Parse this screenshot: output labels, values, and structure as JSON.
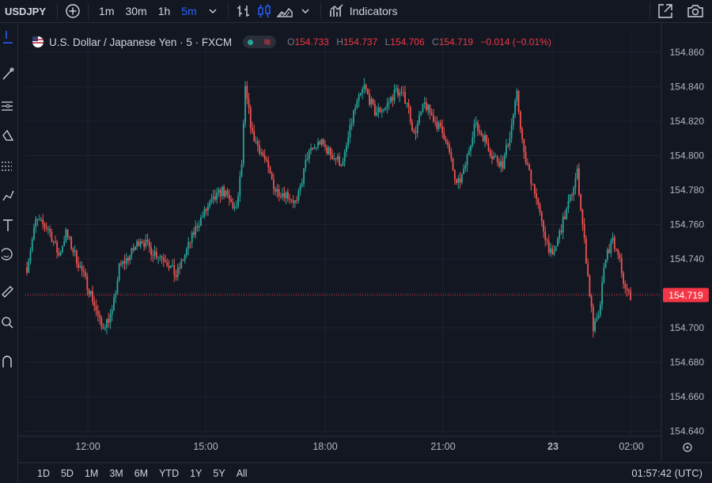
{
  "toolbar": {
    "symbol": "USDJPY",
    "timeframes": [
      "1m",
      "30m",
      "1h",
      "5m"
    ],
    "active_timeframe": "5m",
    "indicators_label": "Indicators"
  },
  "legend": {
    "title": "U.S. Dollar / Japanese Yen · 5 · FXCM",
    "o_label": "O",
    "o": "154.733",
    "h_label": "H",
    "h": "154.737",
    "l_label": "L",
    "l": "154.706",
    "c_label": "C",
    "c": "154.719",
    "change": "−0.014 (−0.01%)"
  },
  "price_axis": {
    "ticks": [
      "154.860",
      "154.840",
      "154.820",
      "154.800",
      "154.780",
      "154.760",
      "154.740",
      "154.720",
      "154.700",
      "154.680",
      "154.660",
      "154.640"
    ],
    "current_price": "154.719"
  },
  "time_axis": {
    "labels": [
      "12:00",
      "15:00",
      "18:00",
      "21:00",
      "23",
      "02:00"
    ]
  },
  "ranges": [
    "1D",
    "5D",
    "1M",
    "3M",
    "6M",
    "YTD",
    "1Y",
    "5Y",
    "All"
  ],
  "clock": "01:57:42 (UTC)",
  "colors": {
    "background": "#131722",
    "up": "#26a69a",
    "down": "#ef5350",
    "accent": "#2962ff",
    "last_price_label": "#f23645"
  },
  "chart_data": {
    "type": "candlestick",
    "timeframe": "5m",
    "ylim": [
      154.635,
      154.865
    ],
    "yticks": [
      154.64,
      154.66,
      154.68,
      154.7,
      154.72,
      154.74,
      154.76,
      154.78,
      154.8,
      154.82,
      154.84,
      154.86
    ],
    "xticks": [
      "12:00",
      "15:00",
      "18:00",
      "21:00",
      "23",
      "02:00"
    ],
    "last_price": 154.719,
    "close_path": [
      [
        0,
        154.735
      ],
      [
        5,
        154.762
      ],
      [
        12,
        154.758
      ],
      [
        18,
        154.742
      ],
      [
        22,
        154.755
      ],
      [
        30,
        154.735
      ],
      [
        36,
        154.72
      ],
      [
        42,
        154.7
      ],
      [
        48,
        154.708
      ],
      [
        52,
        154.735
      ],
      [
        58,
        154.742
      ],
      [
        64,
        154.752
      ],
      [
        70,
        154.745
      ],
      [
        78,
        154.74
      ],
      [
        84,
        154.73
      ],
      [
        90,
        154.745
      ],
      [
        96,
        154.76
      ],
      [
        102,
        154.77
      ],
      [
        110,
        154.78
      ],
      [
        118,
        154.768
      ],
      [
        121,
        154.795
      ],
      [
        123,
        154.838
      ],
      [
        127,
        154.812
      ],
      [
        133,
        154.8
      ],
      [
        140,
        154.78
      ],
      [
        146,
        154.778
      ],
      [
        152,
        154.772
      ],
      [
        158,
        154.8
      ],
      [
        165,
        154.808
      ],
      [
        172,
        154.8
      ],
      [
        178,
        154.795
      ],
      [
        184,
        154.825
      ],
      [
        190,
        154.84
      ],
      [
        196,
        154.825
      ],
      [
        202,
        154.828
      ],
      [
        208,
        154.838
      ],
      [
        214,
        154.832
      ],
      [
        218,
        154.812
      ],
      [
        224,
        154.83
      ],
      [
        230,
        154.82
      ],
      [
        236,
        154.81
      ],
      [
        242,
        154.782
      ],
      [
        246,
        154.79
      ],
      [
        252,
        154.818
      ],
      [
        258,
        154.81
      ],
      [
        262,
        154.8
      ],
      [
        268,
        154.795
      ],
      [
        272,
        154.812
      ],
      [
        276,
        154.835
      ],
      [
        280,
        154.8
      ],
      [
        286,
        154.78
      ],
      [
        290,
        154.76
      ],
      [
        296,
        154.74
      ],
      [
        300,
        154.755
      ],
      [
        306,
        154.775
      ],
      [
        310,
        154.79
      ],
      [
        315,
        154.74
      ],
      [
        319,
        154.7
      ],
      [
        322,
        154.705
      ],
      [
        326,
        154.742
      ],
      [
        330,
        154.75
      ],
      [
        334,
        154.738
      ],
      [
        337,
        154.722
      ],
      [
        340,
        154.719
      ]
    ]
  }
}
